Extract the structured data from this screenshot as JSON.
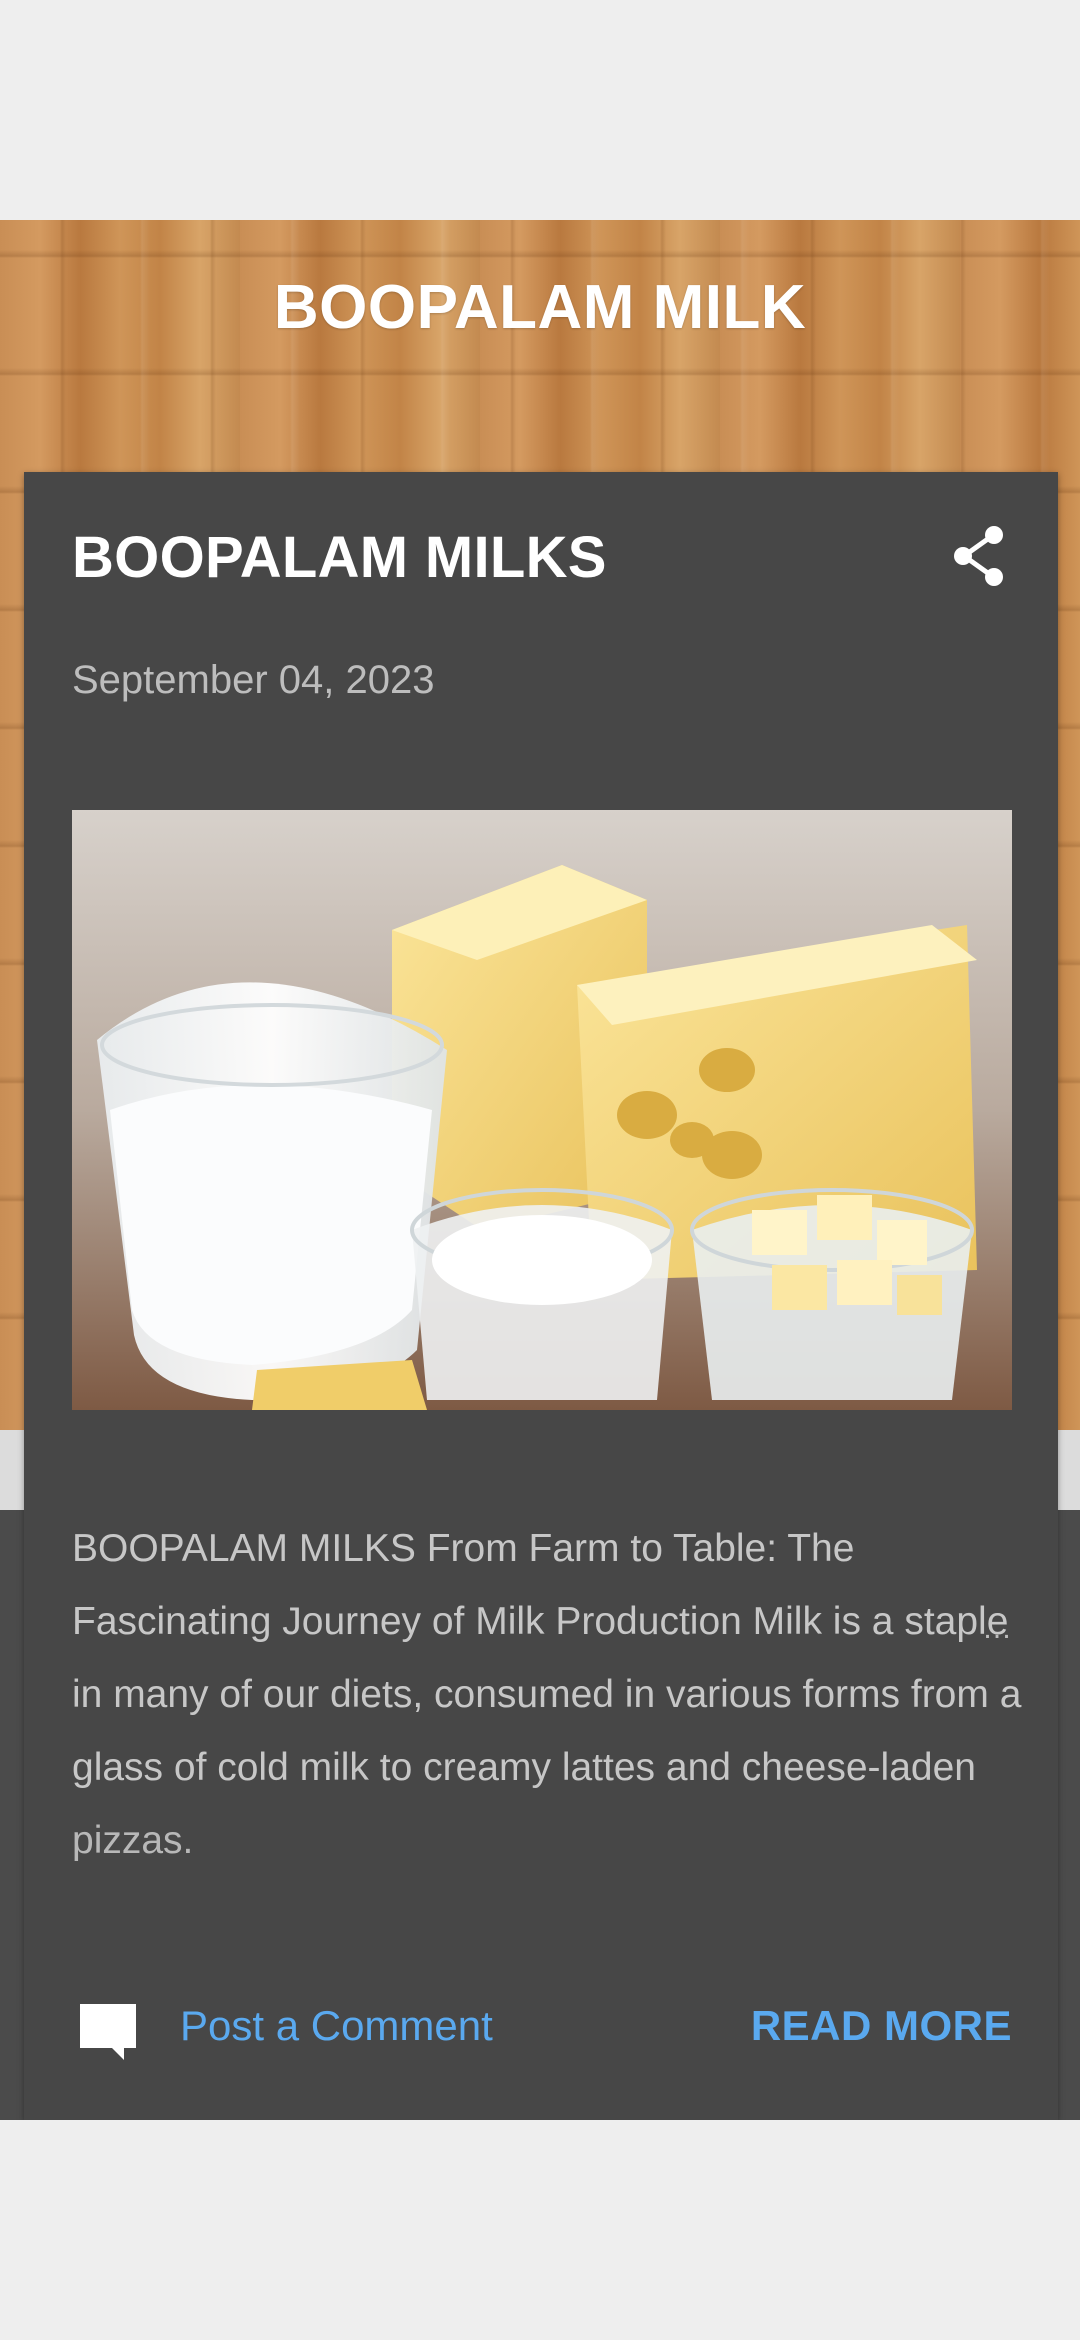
{
  "site": {
    "title": "BOOPALAM MILK"
  },
  "post": {
    "title": "BOOPALAM MILKS",
    "date": "September 04, 2023",
    "image_alt": "milk-and-cheese-photo",
    "snippet_main": "BOOPALAM MILKS  From Farm to Table: The Fascinating Journey of Milk Production Milk is a staple in many of our diets, consumed in various forms from a glass of cold milk to creamy lattes and cheese-laden ",
    "snippet_fade": "pizzas.",
    "ellipsis": "…",
    "comment_label": "Post a Comment",
    "read_more_label": "READ MORE"
  },
  "icons": {
    "share": "share-icon",
    "comment": "comment-icon"
  },
  "colors": {
    "card_bg": "#474747",
    "link": "#5aa9ef",
    "title_text": "#ffffff",
    "meta_text": "#bdbdbd"
  }
}
